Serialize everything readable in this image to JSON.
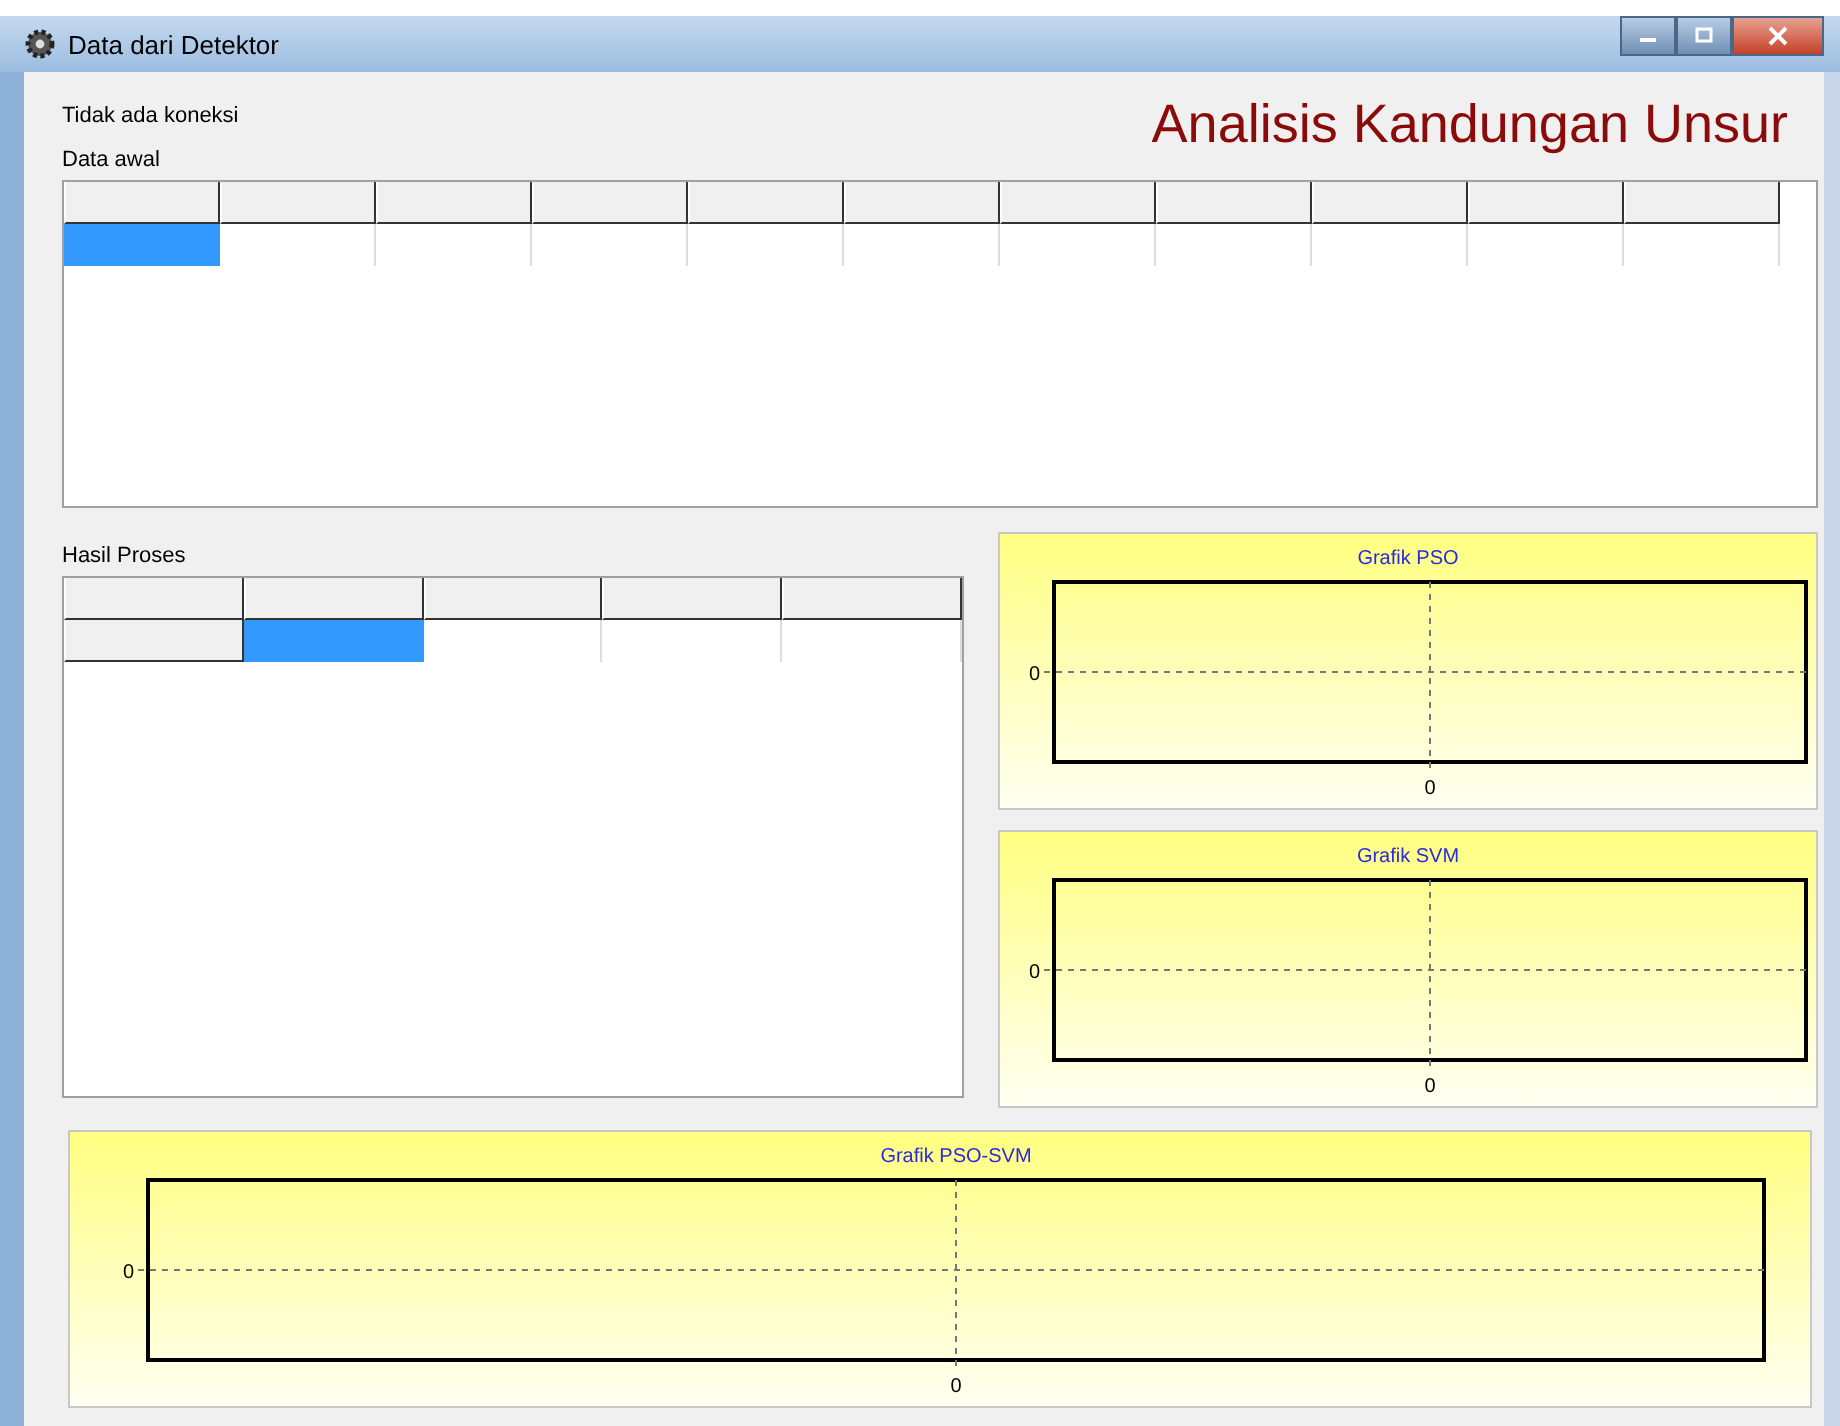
{
  "window": {
    "title": "Data dari Detektor"
  },
  "status_label": "Tidak ada koneksi",
  "app_title": "Analisis Kandungan Unsur",
  "raw_data": {
    "label": "Data awal",
    "rows": [
      {
        "cells": [
          {
            "kind": "header",
            "selected": false
          },
          {
            "kind": "header",
            "selected": false
          },
          {
            "kind": "header",
            "selected": false
          },
          {
            "kind": "header",
            "selected": false
          },
          {
            "kind": "header",
            "selected": false
          },
          {
            "kind": "header",
            "selected": false
          },
          {
            "kind": "header",
            "selected": false
          },
          {
            "kind": "header",
            "selected": false
          },
          {
            "kind": "header",
            "selected": false
          },
          {
            "kind": "header",
            "selected": false
          },
          {
            "kind": "header",
            "selected": false
          }
        ]
      },
      {
        "cells": [
          {
            "kind": "data",
            "selected": true
          },
          {
            "kind": "data",
            "selected": false
          },
          {
            "kind": "data",
            "selected": false
          },
          {
            "kind": "data",
            "selected": false
          },
          {
            "kind": "data",
            "selected": false
          },
          {
            "kind": "data",
            "selected": false
          },
          {
            "kind": "data",
            "selected": false
          },
          {
            "kind": "data",
            "selected": false
          },
          {
            "kind": "data",
            "selected": false
          },
          {
            "kind": "data",
            "selected": false
          },
          {
            "kind": "data",
            "selected": false
          }
        ]
      }
    ]
  },
  "results": {
    "label": "Hasil Proses",
    "rows": [
      {
        "cells": [
          {
            "kind": "header",
            "selected": false
          },
          {
            "kind": "header",
            "selected": false
          },
          {
            "kind": "header",
            "selected": false
          },
          {
            "kind": "header",
            "selected": false
          },
          {
            "kind": "header",
            "selected": false
          }
        ]
      },
      {
        "cells": [
          {
            "kind": "header",
            "selected": false
          },
          {
            "kind": "data",
            "selected": true
          },
          {
            "kind": "data",
            "selected": false
          },
          {
            "kind": "data",
            "selected": false
          },
          {
            "kind": "data",
            "selected": false
          }
        ]
      }
    ]
  },
  "charts": [
    {
      "title": "Grafik PSO",
      "x_axis_label": "0",
      "y_axis_label": "0"
    },
    {
      "title": "Grafik SVM",
      "x_axis_label": "0",
      "y_axis_label": "0"
    },
    {
      "title": "Grafik PSO-SVM",
      "x_axis_label": "0",
      "y_axis_label": "0"
    }
  ]
}
